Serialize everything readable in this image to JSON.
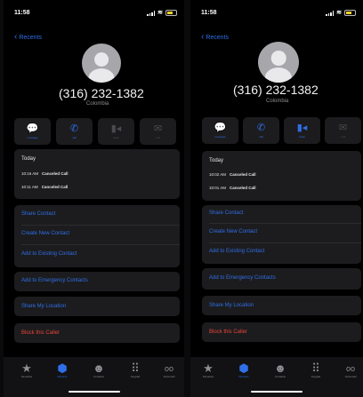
{
  "left": {
    "status": {
      "time": "11:58"
    },
    "back_label": "Recents",
    "phone_number": "(316) 232-1382",
    "location": "Colombia",
    "actions": [
      {
        "label": "message",
        "icon": "message-icon",
        "glyph": "●",
        "enabled": true
      },
      {
        "label": "call",
        "icon": "phone-icon",
        "glyph": "✆",
        "enabled": true
      },
      {
        "label": "video",
        "icon": "video-icon",
        "glyph": "■",
        "enabled": false
      },
      {
        "label": "mail",
        "icon": "mail-icon",
        "glyph": "✉",
        "enabled": false
      }
    ],
    "recents": {
      "day": "Today",
      "calls": [
        {
          "time": "10:16 AM",
          "status": "Canceled Call"
        },
        {
          "time": "10:11 AM",
          "status": "Canceled Call"
        }
      ]
    },
    "contact_options": [
      "Share Contact",
      "Create New Contact",
      "Add to Existing Contact"
    ],
    "emergency": "Add to Emergency Contacts",
    "share_location": "Share My Location",
    "block": "Block this Caller"
  },
  "right": {
    "status": {
      "time": "11:58"
    },
    "back_label": "Recents",
    "phone_number": "(316) 232-1382",
    "location": "Colombia",
    "actions": [
      {
        "label": "message",
        "icon": "message-icon",
        "glyph": "●",
        "enabled": true
      },
      {
        "label": "call",
        "icon": "phone-icon",
        "glyph": "✆",
        "enabled": true
      },
      {
        "label": "video",
        "icon": "video-icon",
        "glyph": "■",
        "enabled": true
      },
      {
        "label": "mail",
        "icon": "mail-icon",
        "glyph": "✉",
        "enabled": false
      }
    ],
    "recents": {
      "day": "Today",
      "calls": [
        {
          "time": "10:02 AM",
          "status": "Canceled Call"
        },
        {
          "time": "10:01 AM",
          "status": "Canceled Call"
        }
      ]
    },
    "contact_options": [
      "Share Contact",
      "Create New Contact",
      "Add to Existing Contact"
    ],
    "emergency": "Add to Emergency Contacts",
    "share_location": "Share My Location",
    "block": "Block this Caller"
  },
  "tabs": [
    {
      "label": "Favorites",
      "icon": "star-icon",
      "glyph": "★",
      "active": false
    },
    {
      "label": "Recents",
      "icon": "clock-icon",
      "glyph": "●",
      "active": true
    },
    {
      "label": "Contacts",
      "icon": "person-icon",
      "glyph": "☻",
      "active": false
    },
    {
      "label": "Keypad",
      "icon": "keypad-icon",
      "glyph": "⠿",
      "active": false
    },
    {
      "label": "Voicemail",
      "icon": "voicemail-icon",
      "glyph": "oo",
      "active": false
    }
  ],
  "colors": {
    "accent": "#2f6fe8",
    "destructive": "#e8453c",
    "background": "#000000",
    "cell": "#1c1c1e"
  }
}
